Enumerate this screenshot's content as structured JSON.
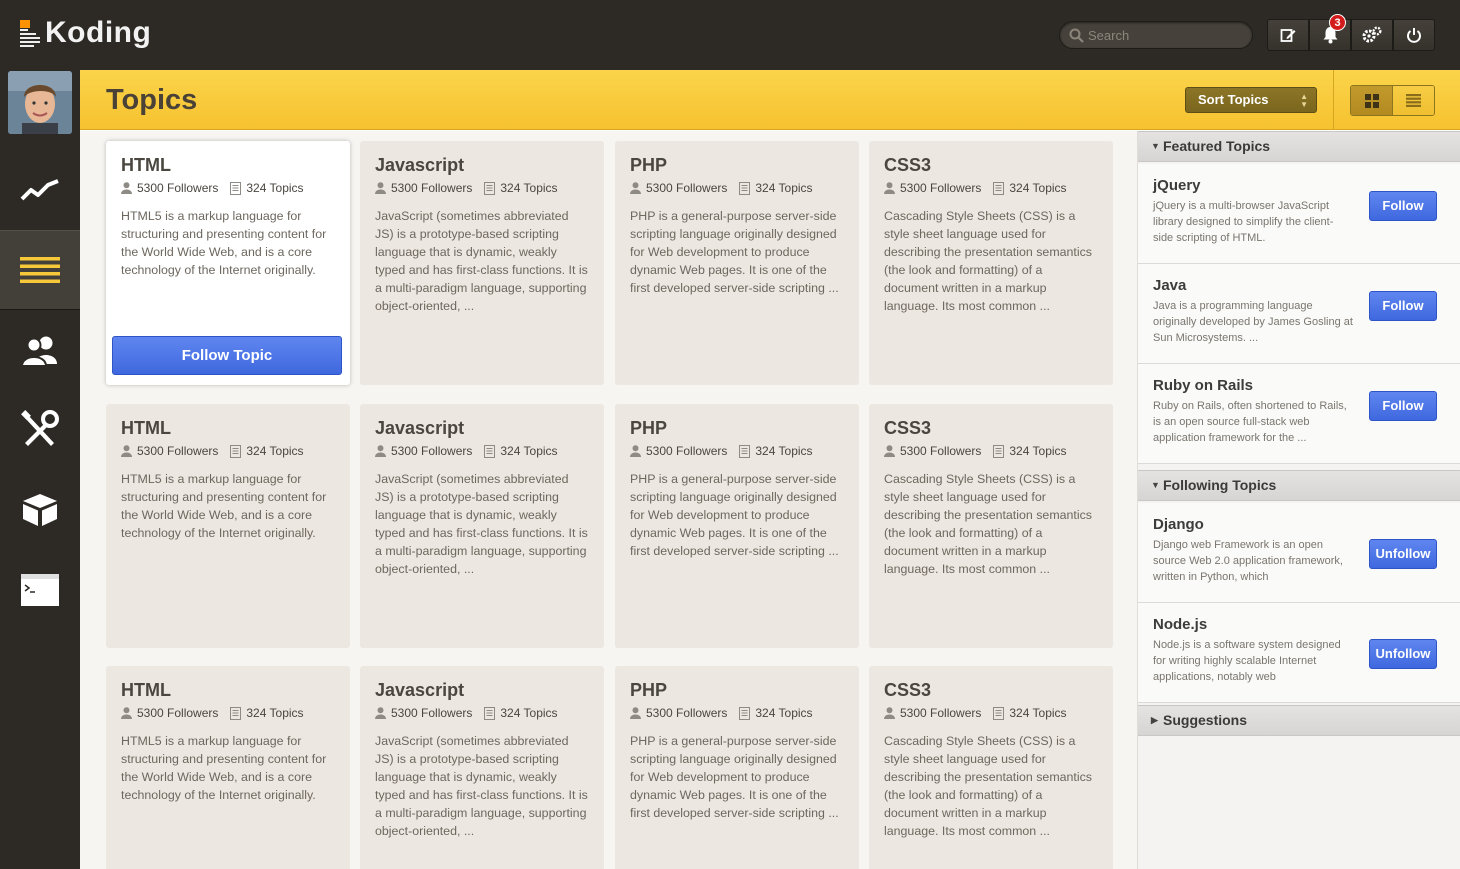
{
  "app": {
    "logo": "Koding"
  },
  "topbar": {
    "search_placeholder": "Search",
    "notifications_count": "3",
    "icons": [
      "compose-icon",
      "bell-icon",
      "gears-icon",
      "power-icon"
    ]
  },
  "sidebar": {
    "items": [
      {
        "name": "activity",
        "icon": "activity-chart-icon"
      },
      {
        "name": "topics",
        "icon": "topics-list-icon",
        "active": true
      },
      {
        "name": "members",
        "icon": "members-icon"
      },
      {
        "name": "develop",
        "icon": "tools-icon"
      },
      {
        "name": "apps",
        "icon": "box-icon"
      },
      {
        "name": "terminal",
        "icon": "terminal-icon"
      }
    ]
  },
  "header": {
    "title": "Topics",
    "sort_label": "Sort Topics",
    "view_options": [
      "grid-view-icon",
      "list-view-icon"
    ]
  },
  "cards": [
    {
      "title": "HTML",
      "followers": "5300 Followers",
      "topics": "324 Topics",
      "description": "HTML5 is a markup language for structuring and presenting content for the World Wide Web, and is a core technology of the Internet originally.",
      "button": "Follow Topic"
    },
    {
      "title": "Javascript",
      "followers": "5300 Followers",
      "topics": "324 Topics",
      "description": "JavaScript (sometimes abbreviated JS) is a prototype-based scripting language that is dynamic, weakly typed and has first-class functions. It is a multi-paradigm language, supporting object-oriented, ..."
    },
    {
      "title": "PHP",
      "followers": "5300 Followers",
      "topics": "324 Topics",
      "description": "PHP is a general-purpose server-side scripting language originally designed for Web development to produce dynamic Web pages. It is one of the first developed server-side scripting ..."
    },
    {
      "title": "CSS3",
      "followers": "5300 Followers",
      "topics": "324 Topics",
      "description": "Cascading Style Sheets (CSS) is a style sheet language used for describing the presentation semantics (the look and formatting) of a document written in a markup language. Its most common ..."
    },
    {
      "title": "HTML",
      "followers": "5300 Followers",
      "topics": "324 Topics",
      "description": "HTML5 is a markup language for structuring and presenting content for the World Wide Web, and is a core technology of the Internet originally."
    },
    {
      "title": "Javascript",
      "followers": "5300 Followers",
      "topics": "324 Topics",
      "description": "JavaScript (sometimes abbreviated JS) is a prototype-based scripting language that is dynamic, weakly typed and has first-class functions. It is a multi-paradigm language, supporting object-oriented, ..."
    },
    {
      "title": "PHP",
      "followers": "5300 Followers",
      "topics": "324 Topics",
      "description": "PHP is a general-purpose server-side scripting language originally designed for Web development to produce dynamic Web pages. It is one of the first developed server-side scripting ..."
    },
    {
      "title": "CSS3",
      "followers": "5300 Followers",
      "topics": "324 Topics",
      "description": "Cascading Style Sheets (CSS) is a style sheet language used for describing the presentation semantics (the look and formatting) of a document written in a markup language. Its most common ..."
    },
    {
      "title": "HTML",
      "followers": "5300 Followers",
      "topics": "324 Topics",
      "description": "HTML5 is a markup language for structuring and presenting content for the World Wide Web, and is a core technology of the Internet originally."
    },
    {
      "title": "Javascript",
      "followers": "5300 Followers",
      "topics": "324 Topics",
      "description": "JavaScript (sometimes abbreviated JS) is a prototype-based scripting language that is dynamic, weakly typed and has first-class functions. It is a multi-paradigm language, supporting object-oriented, ..."
    },
    {
      "title": "PHP",
      "followers": "5300 Followers",
      "topics": "324 Topics",
      "description": "PHP is a general-purpose server-side scripting language originally designed for Web development to produce dynamic Web pages. It is one of the first developed server-side scripting ..."
    },
    {
      "title": "CSS3",
      "followers": "5300 Followers",
      "topics": "324 Topics",
      "description": "Cascading Style Sheets (CSS) is a style sheet language used for describing the presentation semantics (the look and formatting) of a document written in a markup language. Its most common ..."
    }
  ],
  "right_panel": {
    "featured": {
      "title": "Featured Topics",
      "items": [
        {
          "title": "jQuery",
          "description": "jQuery is a multi-browser JavaScript library designed to simplify the client-side scripting of HTML.",
          "button": "Follow"
        },
        {
          "title": "Java",
          "description": "Java is a programming language originally developed by James Gosling at Sun Microsystems. ...",
          "button": "Follow"
        },
        {
          "title": "Ruby on Rails",
          "description": "Ruby on Rails, often shortened to Rails, is an open source full-stack web application framework for the ...",
          "button": "Follow"
        }
      ]
    },
    "following": {
      "title": "Following Topics",
      "items": [
        {
          "title": "Django",
          "description": "Django web Framework is an open source Web 2.0 application framework, written in Python, which",
          "button": "Unfollow"
        },
        {
          "title": "Node.js",
          "description": "Node.js is a software system designed for writing highly scalable Internet applications, notably web",
          "button": "Unfollow"
        }
      ]
    },
    "suggestions": {
      "title": "Suggestions"
    }
  },
  "colors": {
    "accent": "#f7c83a",
    "button_blue": "#4a72e6",
    "sidebar": "#2d2a25"
  }
}
